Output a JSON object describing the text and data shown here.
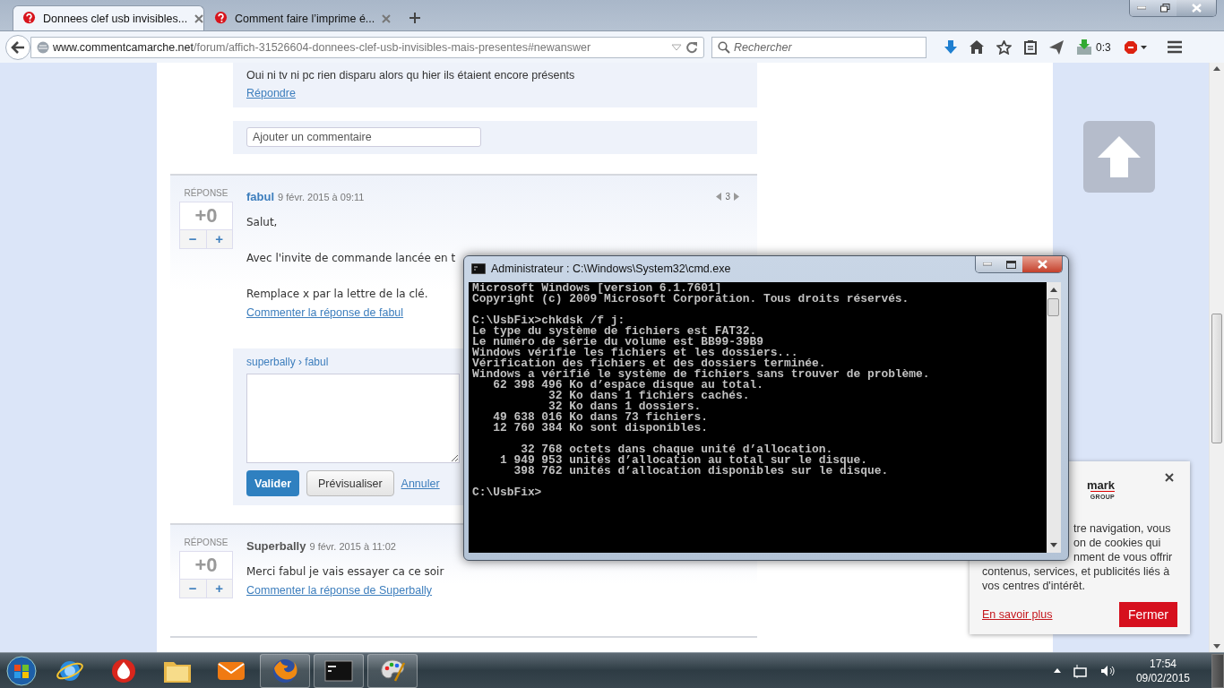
{
  "browser": {
    "tabs": [
      {
        "title": "Donnees clef usb invisibles...",
        "selected": true
      },
      {
        "title": "Comment faire l’imprime é...",
        "selected": false
      }
    ],
    "url": {
      "domain": "www.commentcamarche.net",
      "path": "/forum/affich-31526604-donnees-clef-usb-invisibles-mais-presentes#newanswer"
    },
    "search": {
      "placeholder": "Rechercher"
    },
    "counter": "0:3"
  },
  "page": {
    "previous_comment": {
      "text": "Oui ni tv ni pc rien disparu alors qu hier ils étaient encore présents",
      "reply_link": "Répondre"
    },
    "comment_field": {
      "placeholder": "Ajouter un commentaire"
    },
    "posts": [
      {
        "label": "RÉPONSE",
        "score": "+0",
        "minus": "−",
        "plus": "+",
        "author": "fabul",
        "date": "9 févr. 2015 à 09:11",
        "pager": "3",
        "paragraphs": [
          "Salut,",
          "Avec l'invite de commande lancée en t",
          "Remplace x par la lettre de la clé."
        ],
        "comment_link": "Commenter la réponse de fabul",
        "reply_form": {
          "breadcrumb": "superbally › fabul",
          "buttons": [
            {
              "label": "Valider",
              "kind": "primary"
            },
            {
              "label": "Prévisualiser",
              "kind": "secondary"
            },
            {
              "label": "Annuler",
              "kind": "link"
            }
          ]
        }
      },
      {
        "label": "RÉPONSE",
        "score": "+0",
        "minus": "−",
        "plus": "+",
        "author": "Superbally",
        "date": "9 févr. 2015 à 11:02",
        "paragraphs": [
          "Merci fabul je vais essayer ca ce soir"
        ],
        "comment_link": "Commenter la réponse de Superbally"
      }
    ]
  },
  "cmd_window": {
    "title": "Administrateur : C:\\Windows\\System32\\cmd.exe",
    "blocks": [
      [
        "Microsoft Windows [version 6.1.7601]",
        "Copyright (c) 2009 Microsoft Corporation. Tous droits réservés."
      ],
      [
        "C:\\UsbFix>chkdsk /f j:",
        "Le type du système de fichiers est FAT32.",
        "Le numéro de série du volume est BB99-39B9",
        "Windows vérifie les fichiers et les dossiers...",
        "Vérification des fichiers et des dossiers terminée.",
        "Windows a vérifié le système de fichiers sans trouver de problème.",
        "   62 398 496 Ko d’espace disque au total.",
        "           32 Ko dans 1 fichiers cachés.",
        "           32 Ko dans 1 dossiers.",
        "   49 638 016 Ko dans 73 fichiers.",
        "   12 760 384 Ko sont disponibles."
      ],
      [
        "       32 768 octets dans chaque unité d’allocation.",
        "    1 949 953 unités d’allocation au total sur le disque.",
        "      398 762 unités d’allocation disponibles sur le disque."
      ],
      [
        "C:\\UsbFix>"
      ]
    ]
  },
  "cookie_banner": {
    "logo_fragment": "mark",
    "logo_subtitle": "GROUP",
    "fragments": [
      "tre navigation, vous",
      "on de cookies qui",
      "nment de vous offrir"
    ],
    "text": "contenus, services, et publicités liés à vos centres d'intérêt.",
    "link": "En savoir plus",
    "button": "Fermer"
  },
  "taskbar": {
    "apps": [
      {
        "kind": "globe",
        "running": false
      },
      {
        "kind": "shield",
        "running": false
      },
      {
        "kind": "folder",
        "running": false
      },
      {
        "kind": "mail",
        "running": false
      },
      {
        "kind": "fox",
        "running": true
      },
      {
        "kind": "console",
        "running": true
      },
      {
        "kind": "palette",
        "running": true
      }
    ],
    "time": "17:54",
    "date": "09/02/2015"
  }
}
